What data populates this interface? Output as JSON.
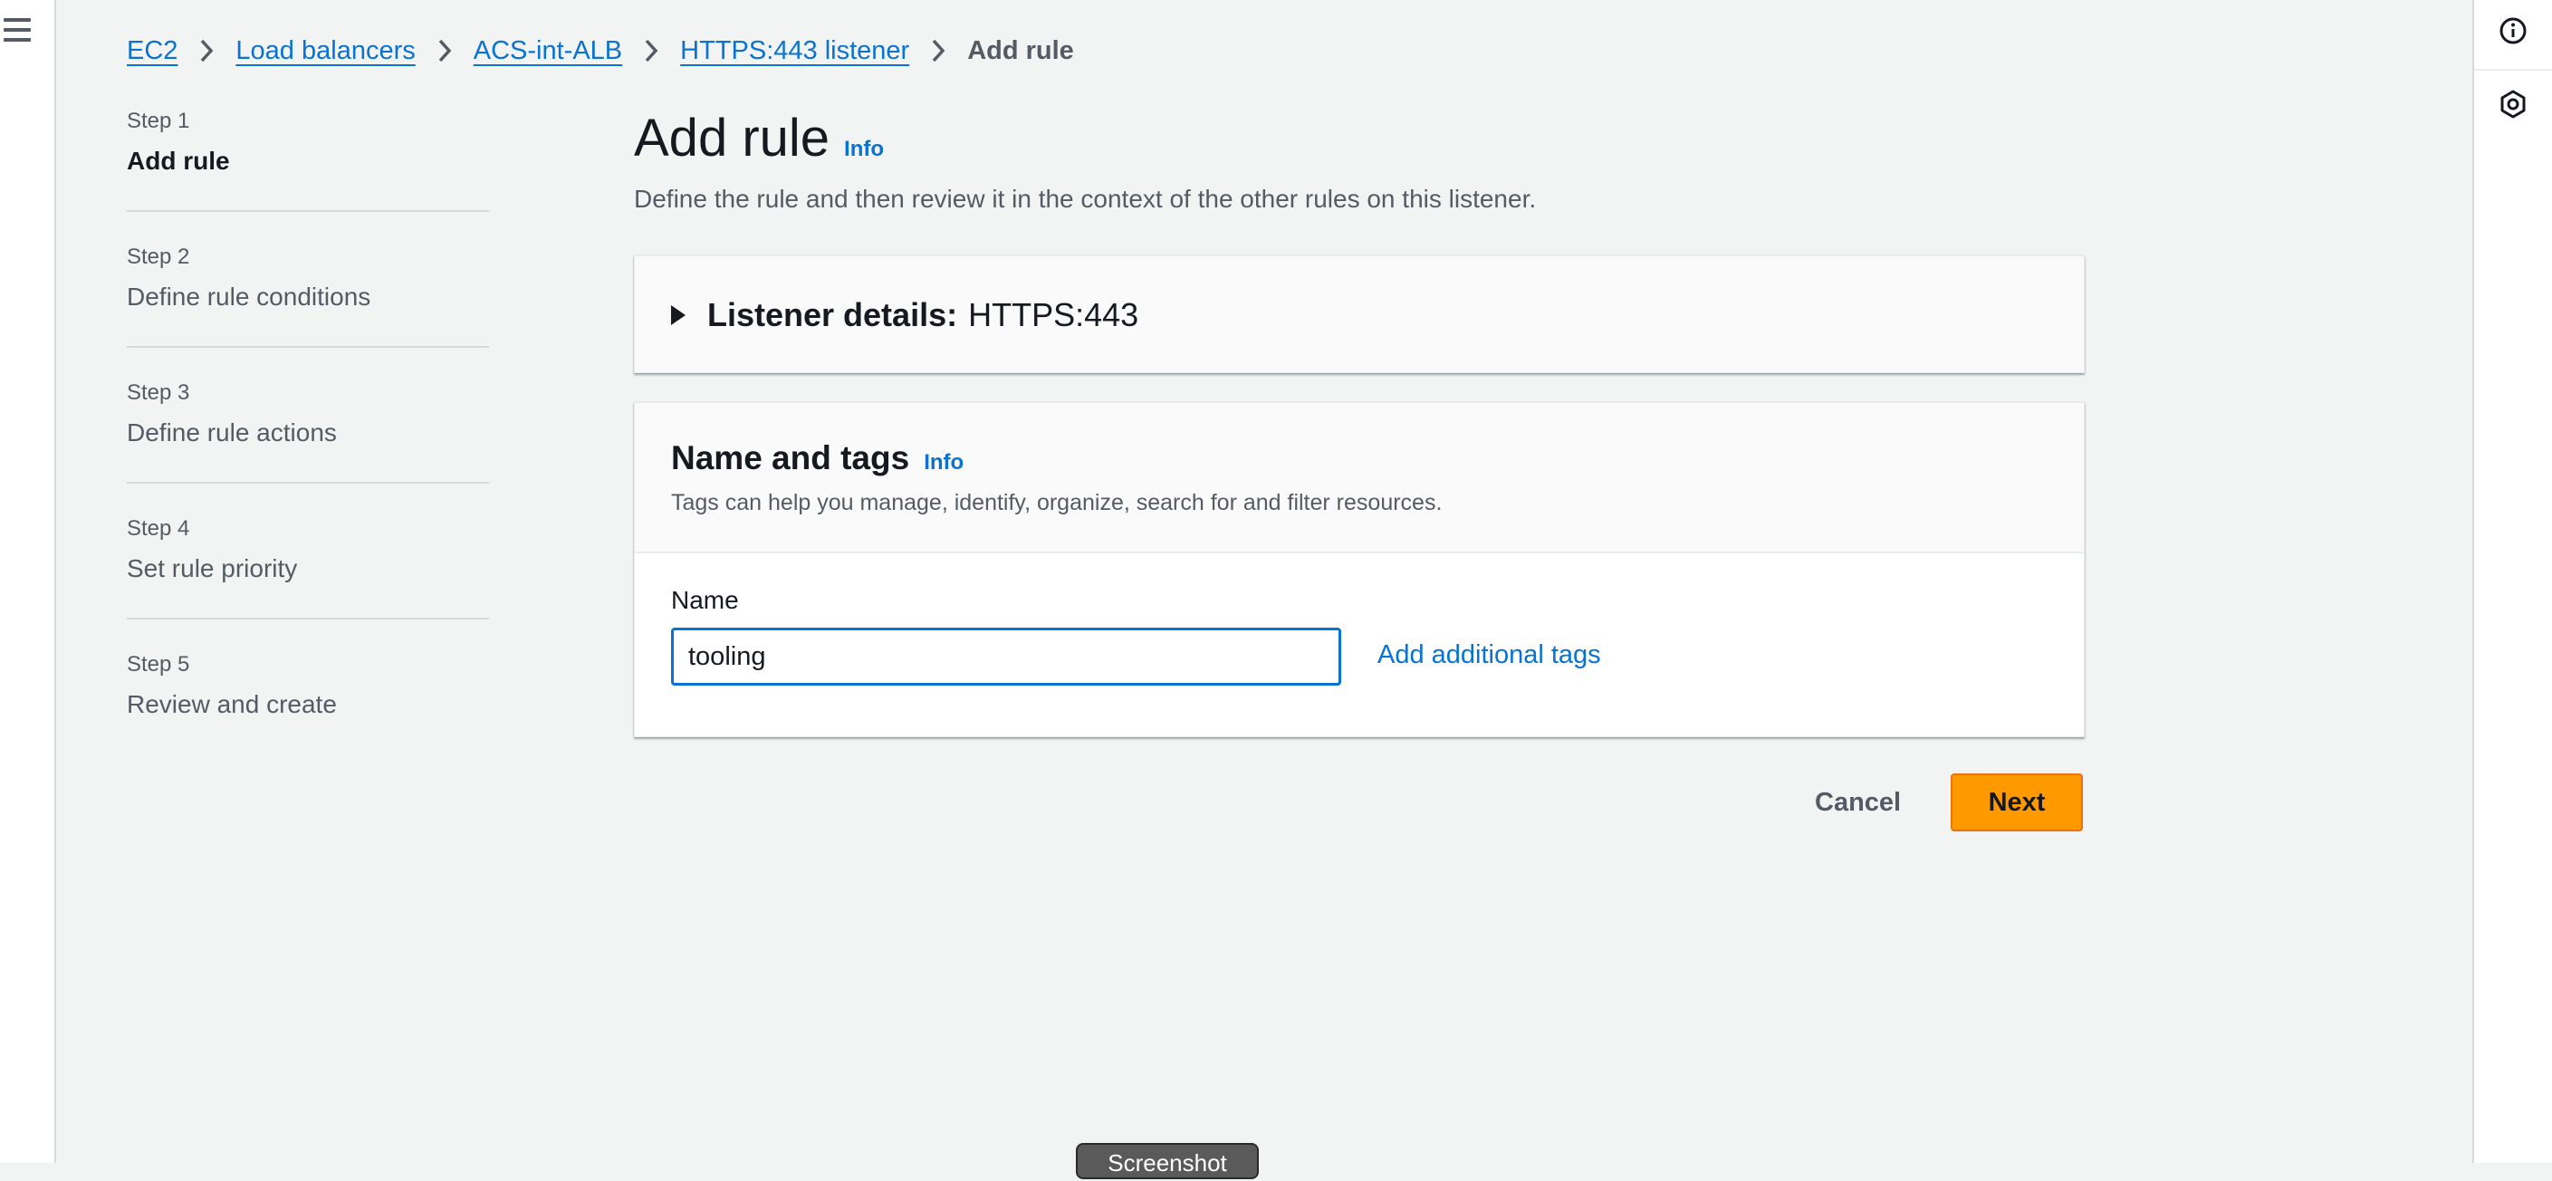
{
  "breadcrumb": {
    "items": [
      "EC2",
      "Load balancers",
      "ACS-int-ALB",
      "HTTPS:443 listener"
    ],
    "current": "Add rule"
  },
  "steps": [
    {
      "num": "Step 1",
      "title": "Add rule",
      "active": true
    },
    {
      "num": "Step 2",
      "title": "Define rule conditions",
      "active": false
    },
    {
      "num": "Step 3",
      "title": "Define rule actions",
      "active": false
    },
    {
      "num": "Step 4",
      "title": "Set rule priority",
      "active": false
    },
    {
      "num": "Step 5",
      "title": "Review and create",
      "active": false
    }
  ],
  "page": {
    "title": "Add rule",
    "info": "Info",
    "description": "Define the rule and then review it in the context of the other rules on this listener."
  },
  "listener": {
    "label": "Listener details:",
    "value": "HTTPS:443"
  },
  "tags": {
    "title": "Name and tags",
    "info": "Info",
    "description": "Tags can help you manage, identify, organize, search for and filter resources.",
    "name_label": "Name",
    "name_value": "tooling",
    "add_tags": "Add additional tags"
  },
  "actions": {
    "cancel": "Cancel",
    "next": "Next"
  },
  "tooltip": "Screenshot",
  "icons": {
    "menu": "hamburger-menu-icon",
    "info": "info-circle-icon",
    "settings": "hexagon-settings-icon",
    "breadcrumb_separator": "chevron-right-icon",
    "expand": "caret-right-icon"
  },
  "colors": {
    "link": "#0972d3",
    "primary_button": "#ff9900",
    "page_background": "#f2f3f3"
  }
}
